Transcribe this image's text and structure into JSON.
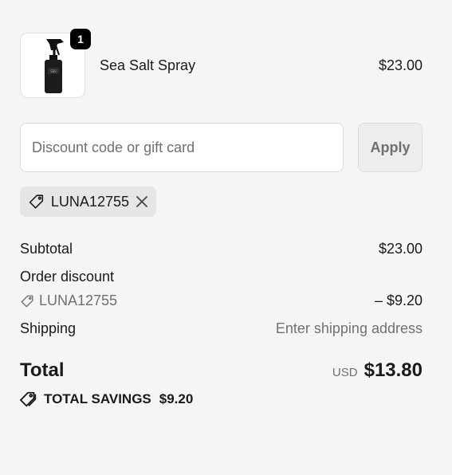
{
  "line_item": {
    "quantity": "1",
    "name": "Sea Salt Spray",
    "price": "$23.00",
    "image_icon": "spray-bottle"
  },
  "discount": {
    "placeholder": "Discount code or gift card",
    "value": "",
    "apply_label": "Apply",
    "applied_code": "LUNA12755"
  },
  "summary": {
    "subtotal_label": "Subtotal",
    "subtotal_value": "$23.00",
    "order_discount_label": "Order discount",
    "discount_code": "LUNA12755",
    "discount_value": "– $9.20",
    "shipping_label": "Shipping",
    "shipping_value": "Enter shipping address",
    "total_label": "Total",
    "currency": "USD",
    "total_value": "$13.80",
    "savings_label": "TOTAL SAVINGS",
    "savings_value": "$9.20"
  },
  "colors": {
    "background": "#f5f5f5",
    "text": "#1a1a1a",
    "muted": "#707070",
    "badge": "#000000"
  }
}
